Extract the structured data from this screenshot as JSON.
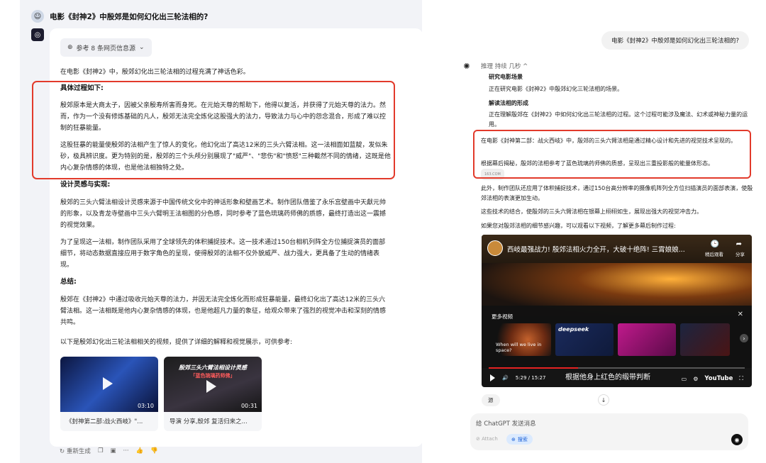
{
  "left": {
    "question": "电影《封神2》中殷郊是如何幻化出三轮法相的?",
    "ref_label": "参考 8 条网页信息源",
    "intro": "在电影《封神2》中，殷郊幻化出三轮法相的过程充满了神话色彩。",
    "h1": "具体过程如下:",
    "p1": "殷郊原本是大商太子，因被父亲殷寿所害而身死。在元始天尊的帮助下，他得以复活，并获得了元始天尊的法力。然而，作为一个没有修炼基础的凡人，殷郊无法完全炼化这股强大的法力，导致法力与心中的怨念混合，形成了难以控制的狂暴能量。",
    "p2": "这股狂暴的能量使殷郊的法相产生了惊人的变化，他幻化出了高达12米的三头六臂法相。这一法相面如蓝靛，发似朱砂，极具辨识度。更为特别的是，殷郊的三个头颅分别展现了\"威严\"、\"悲伤\"和\"愤怒\"三种截然不同的情绪，这既是他内心复杂情感的体现，也是他法相独特之处。",
    "h2": "设计灵感与实现:",
    "p3": "殷郊的三头六臂法相设计灵感来源于中国传统文化中的神话形象和壁画艺术。制作团队借鉴了永乐宫壁画中天獻元帅的形象，以及青龙寺壁画中三头六臂明王法相图的分色感，同时参考了蓝色琉璃药师佛的质感，最终打造出这一震撼的视觉效果。",
    "p4": "为了呈现这一法相，制作团队采用了全球领先的体积捕捉技术。这一技术通过150台相机列阵全方位捕捉演员的面部细节，将动态数据直接应用于数字角色的呈现，使得殷郊的法相不仅外貌威严、战力强大，更具备了生动的情绪表现。",
    "h3": "总结:",
    "p5": "殷郊在《封神2》中通过吸收元始天尊的法力，并因无法完全炼化而形成狂暴能量，最终幻化出了高达12米的三头六臂法相。这一法相既是他内心复杂情感的体现，也是他超凡力量的象征，给观众带来了强烈的视觉冲击和深刻的情感共鸣。",
    "p6": "以下是殷郊幻化出三轮法相相关的视频，提供了详细的解释和视觉展示，可供参考:",
    "videos": [
      {
        "dur": "03:10",
        "caption": "《封神第二部:战火西岐》\"...",
        "title": "",
        "subtitle": ""
      },
      {
        "dur": "00:31",
        "caption": "导演 分享,殷郊 复活归来之...",
        "title": "殷郊三头六臂法相设计灵感",
        "subtitle": "「蓝色琉璃药师佛」"
      }
    ],
    "actions": {
      "regen": "重新生成",
      "more": "···"
    }
  },
  "right": {
    "question": "电影《封神2》中殷郊是如何幻化出三轮法相的?",
    "thinking": "推理 持续 几秒 ^",
    "t1_h": "研究电影场景",
    "t1_p": "正在研究电影《封神2》中殷郊幻化三轮法相的场景。",
    "t2_h": "解读法相的形成",
    "t2_p": "正在理解殷郊在《封神2》中如何幻化出三轮法相的过程。这个过程可能涉及魔法、幻术或神秘力量的运用。",
    "a1": "在电影《封神第二部：战火西岐》中，殷郊的三头六臂法相是通过精心设计和先进的视觉技术呈现的。",
    "a2": "根据幕后揭秘，殷郊的法相参考了蓝色琉璃药师佛的质感，呈现出三重投影般的能量体形态。",
    "src_chip": "163.COM",
    "a3": "此外，制作团队还应用了体积捕捉技术，通过150台高分辨率的摄像机阵列全方位扫描演员的面部表演，使殷郊法相的表演更加生动。",
    "a4": "这些技术的结合，使殷郊的三头六臂法相在银幕上栩栩如生，展现出强大的视觉冲击力。",
    "a5": "如果您对殷郊法相的细节感兴趣，可以观看以下视频，了解更多幕后制作过程:",
    "player": {
      "title": "西岐最强战力! 殷郊法相火力全开，大破十绝阵! 三霄娘娘...",
      "later": "稍后观看",
      "share": "分享",
      "more_videos": "更多视频",
      "time": "5:29 / 15:27",
      "subtitle": "根据他身上红色的缎带判断",
      "youtube": "YouTube",
      "progress": 0.35,
      "mv": [
        {
          "t": "When will we live in space?",
          "t2": ""
        },
        {
          "t": "",
          "t2": "deepseek"
        },
        {
          "t": "",
          "t2": ""
        },
        {
          "t": "",
          "t2": ""
        }
      ]
    },
    "src_label": "源",
    "composer_placeholder": "给 ChatGPT 发送消息",
    "attach": "Attach",
    "search": "搜索"
  }
}
